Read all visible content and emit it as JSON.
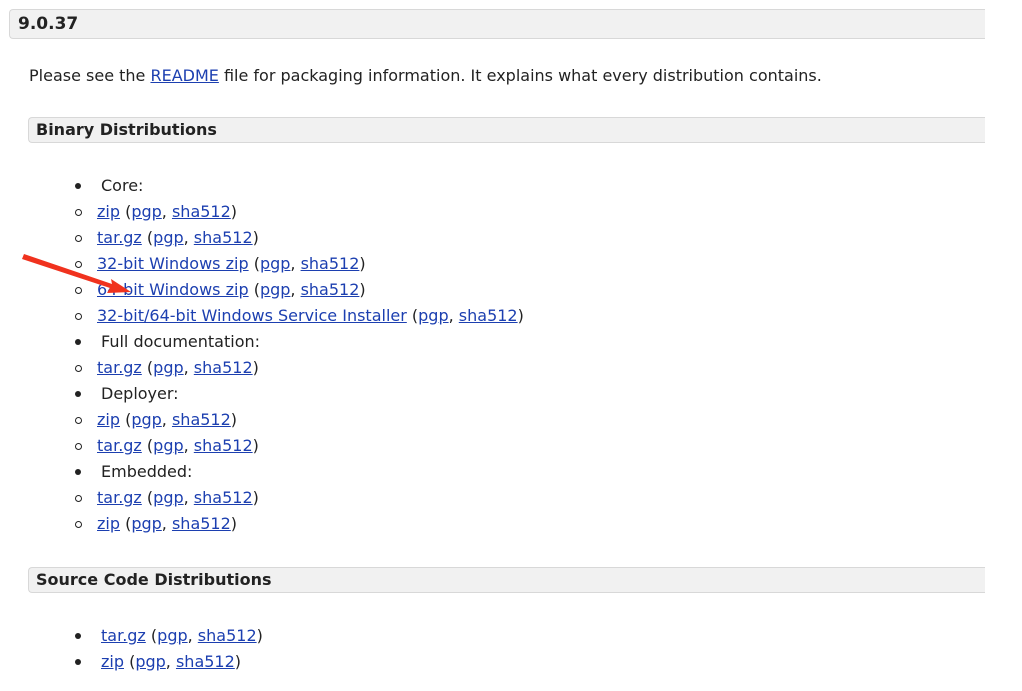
{
  "version": "9.0.37",
  "intro": {
    "before": "Please see the ",
    "link": "README",
    "after": " file for packaging information. It explains what every distribution contains."
  },
  "binary": {
    "title": "Binary Distributions",
    "core_label": "Core:",
    "core": [
      {
        "name": "zip",
        "pgp": "pgp",
        "sha": "sha512"
      },
      {
        "name": "tar.gz",
        "pgp": "pgp",
        "sha": "sha512"
      },
      {
        "name": "32-bit Windows zip",
        "pgp": "pgp",
        "sha": "sha512"
      },
      {
        "name": "64-bit Windows zip",
        "pgp": "pgp",
        "sha": "sha512"
      },
      {
        "name": "32-bit/64-bit Windows Service Installer",
        "pgp": "pgp",
        "sha": "sha512"
      }
    ],
    "docs_label": "Full documentation:",
    "docs": [
      {
        "name": "tar.gz",
        "pgp": "pgp",
        "sha": "sha512"
      }
    ],
    "deployer_label": "Deployer:",
    "deployer": [
      {
        "name": "zip",
        "pgp": "pgp",
        "sha": "sha512"
      },
      {
        "name": "tar.gz",
        "pgp": "pgp",
        "sha": "sha512"
      }
    ],
    "embedded_label": "Embedded:",
    "embedded": [
      {
        "name": "tar.gz",
        "pgp": "pgp",
        "sha": "sha512"
      },
      {
        "name": "zip",
        "pgp": "pgp",
        "sha": "sha512"
      }
    ]
  },
  "source": {
    "title": "Source Code Distributions",
    "items": [
      {
        "name": "tar.gz",
        "pgp": "pgp",
        "sha": "sha512"
      },
      {
        "name": "zip",
        "pgp": "pgp",
        "sha": "sha512"
      }
    ]
  },
  "annotation": {
    "color": "#f0321e",
    "icon": "arrow-icon"
  }
}
